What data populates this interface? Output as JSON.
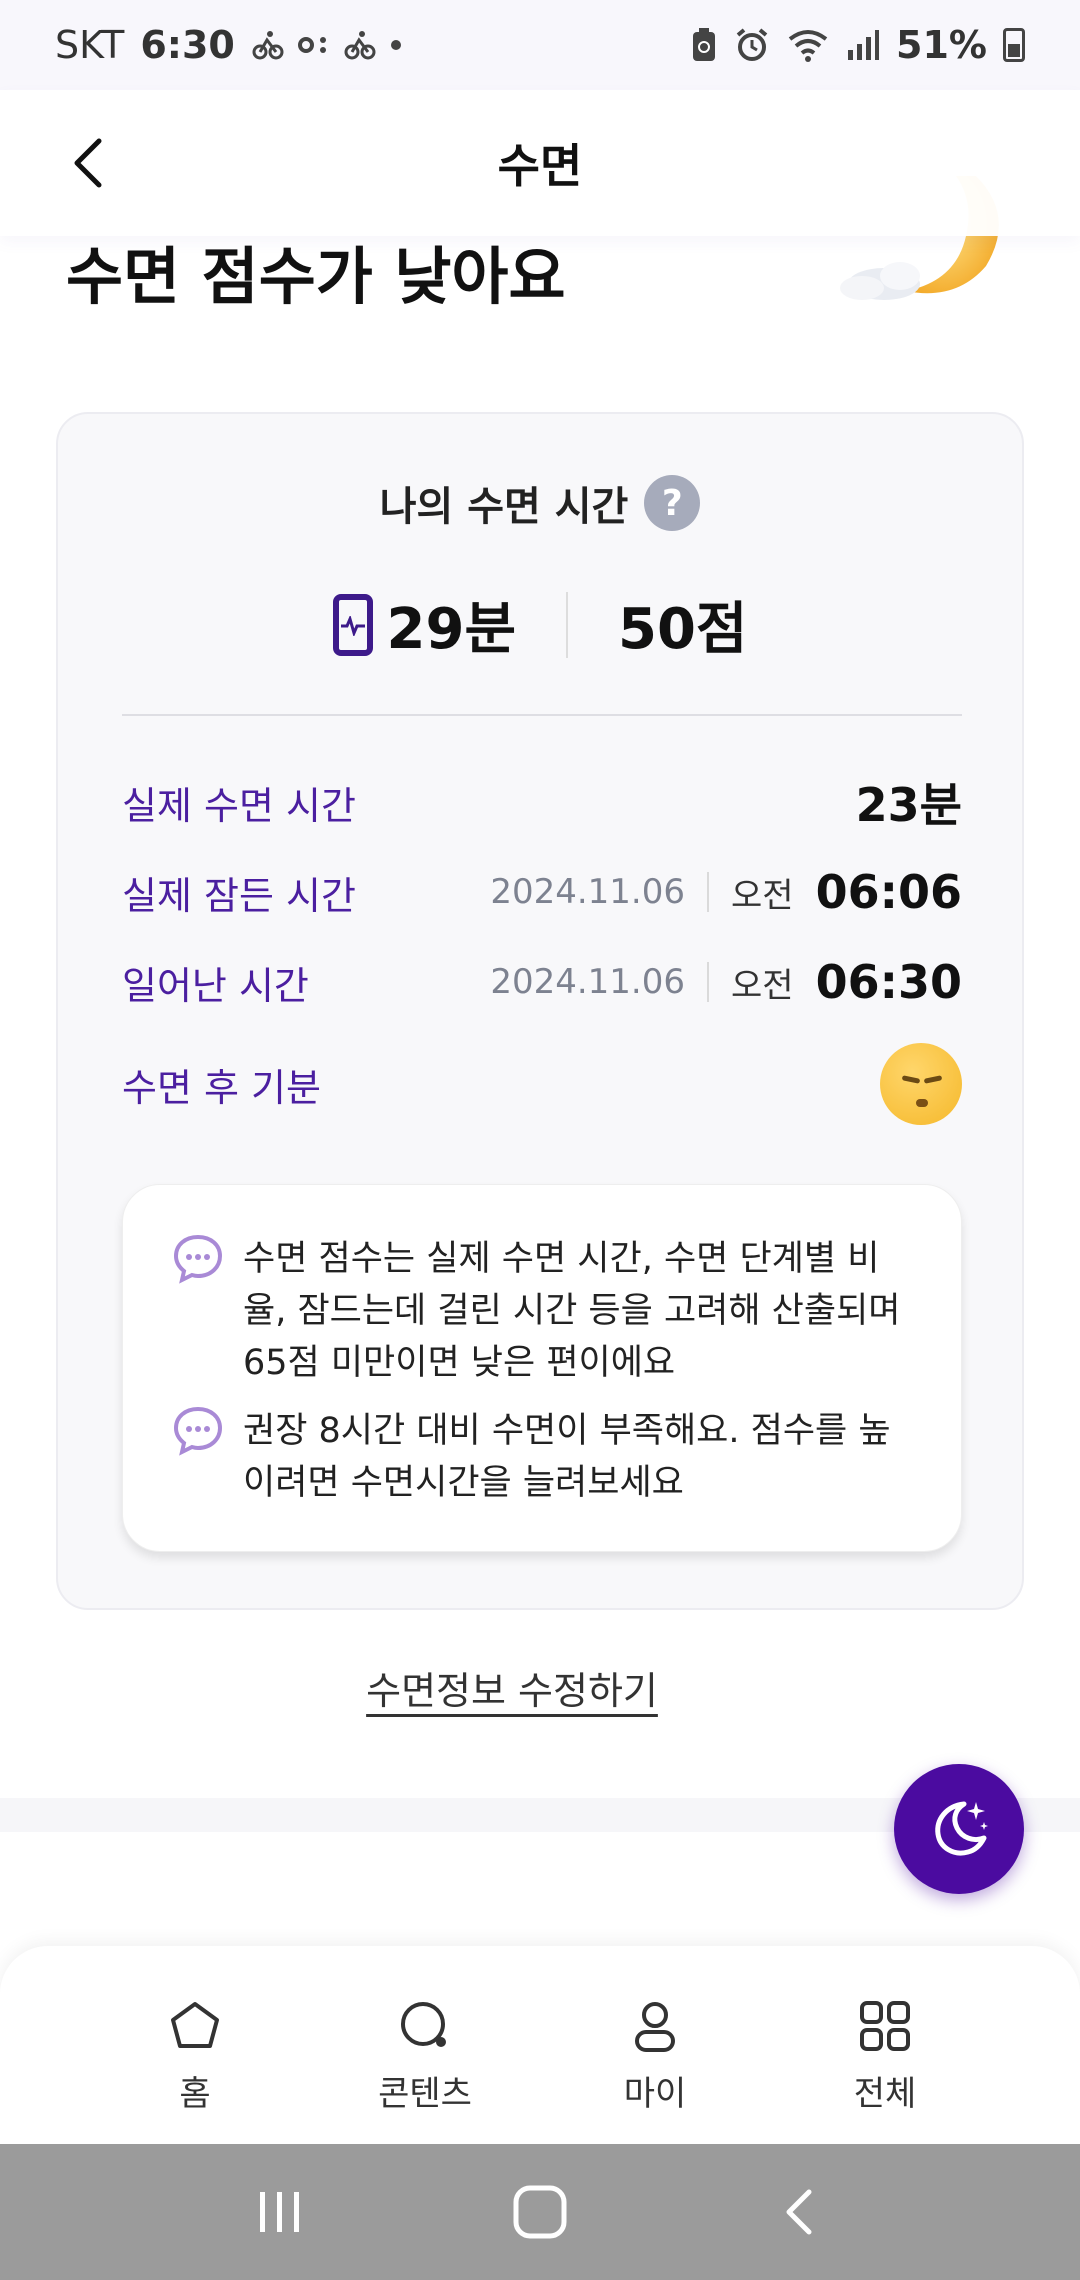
{
  "status_bar": {
    "carrier": "SKT",
    "time": "6:30",
    "battery_percent": "51%"
  },
  "header": {
    "title": "수면",
    "back_icon": "chevron-left-icon"
  },
  "hero": {
    "title": "수면 점수가 낮아요",
    "art_icon": "crescent-moon-cloud-illustration"
  },
  "card": {
    "title": "나의 수면 시간",
    "help_icon_text": "?",
    "summary": {
      "duration": "29분",
      "score": "50점",
      "device_icon": "phone-activity-icon"
    },
    "rows": [
      {
        "label": "실제 수면 시간",
        "value": "23분"
      },
      {
        "label": "실제 잠든 시간",
        "date": "2024.11.06",
        "ampm": "오전",
        "time": "06:06"
      },
      {
        "label": "일어난 시간",
        "date": "2024.11.06",
        "ampm": "오전",
        "time": "06:30"
      },
      {
        "label": "수면 후 기분",
        "mood_icon": "sleepy-face-emoji"
      }
    ],
    "info": [
      {
        "text": "수면 점수는 실제 수면 시간, 수면 단계별 비율, 잠드는데 걸린 시간 등을 고려해 산출되며 65점 미만이면 낮은 편이에요"
      },
      {
        "text": "권장 8시간 대비 수면이 부족해요. 점수를 높이려면 수면시간을 늘려보세요"
      }
    ]
  },
  "edit_link": "수면정보 수정하기",
  "fab": {
    "icon": "moon-sparkle-icon"
  },
  "bottom_nav": [
    {
      "label": "홈",
      "icon": "home-icon"
    },
    {
      "label": "콘텐츠",
      "icon": "search-icon"
    },
    {
      "label": "마이",
      "icon": "person-icon"
    },
    {
      "label": "전체",
      "icon": "grid-icon"
    }
  ],
  "colors": {
    "accent": "#4b0ba0",
    "label_purple": "#4b1fa0",
    "card_bg": "#f8f8fa",
    "system_nav": "#9b9b9b"
  }
}
